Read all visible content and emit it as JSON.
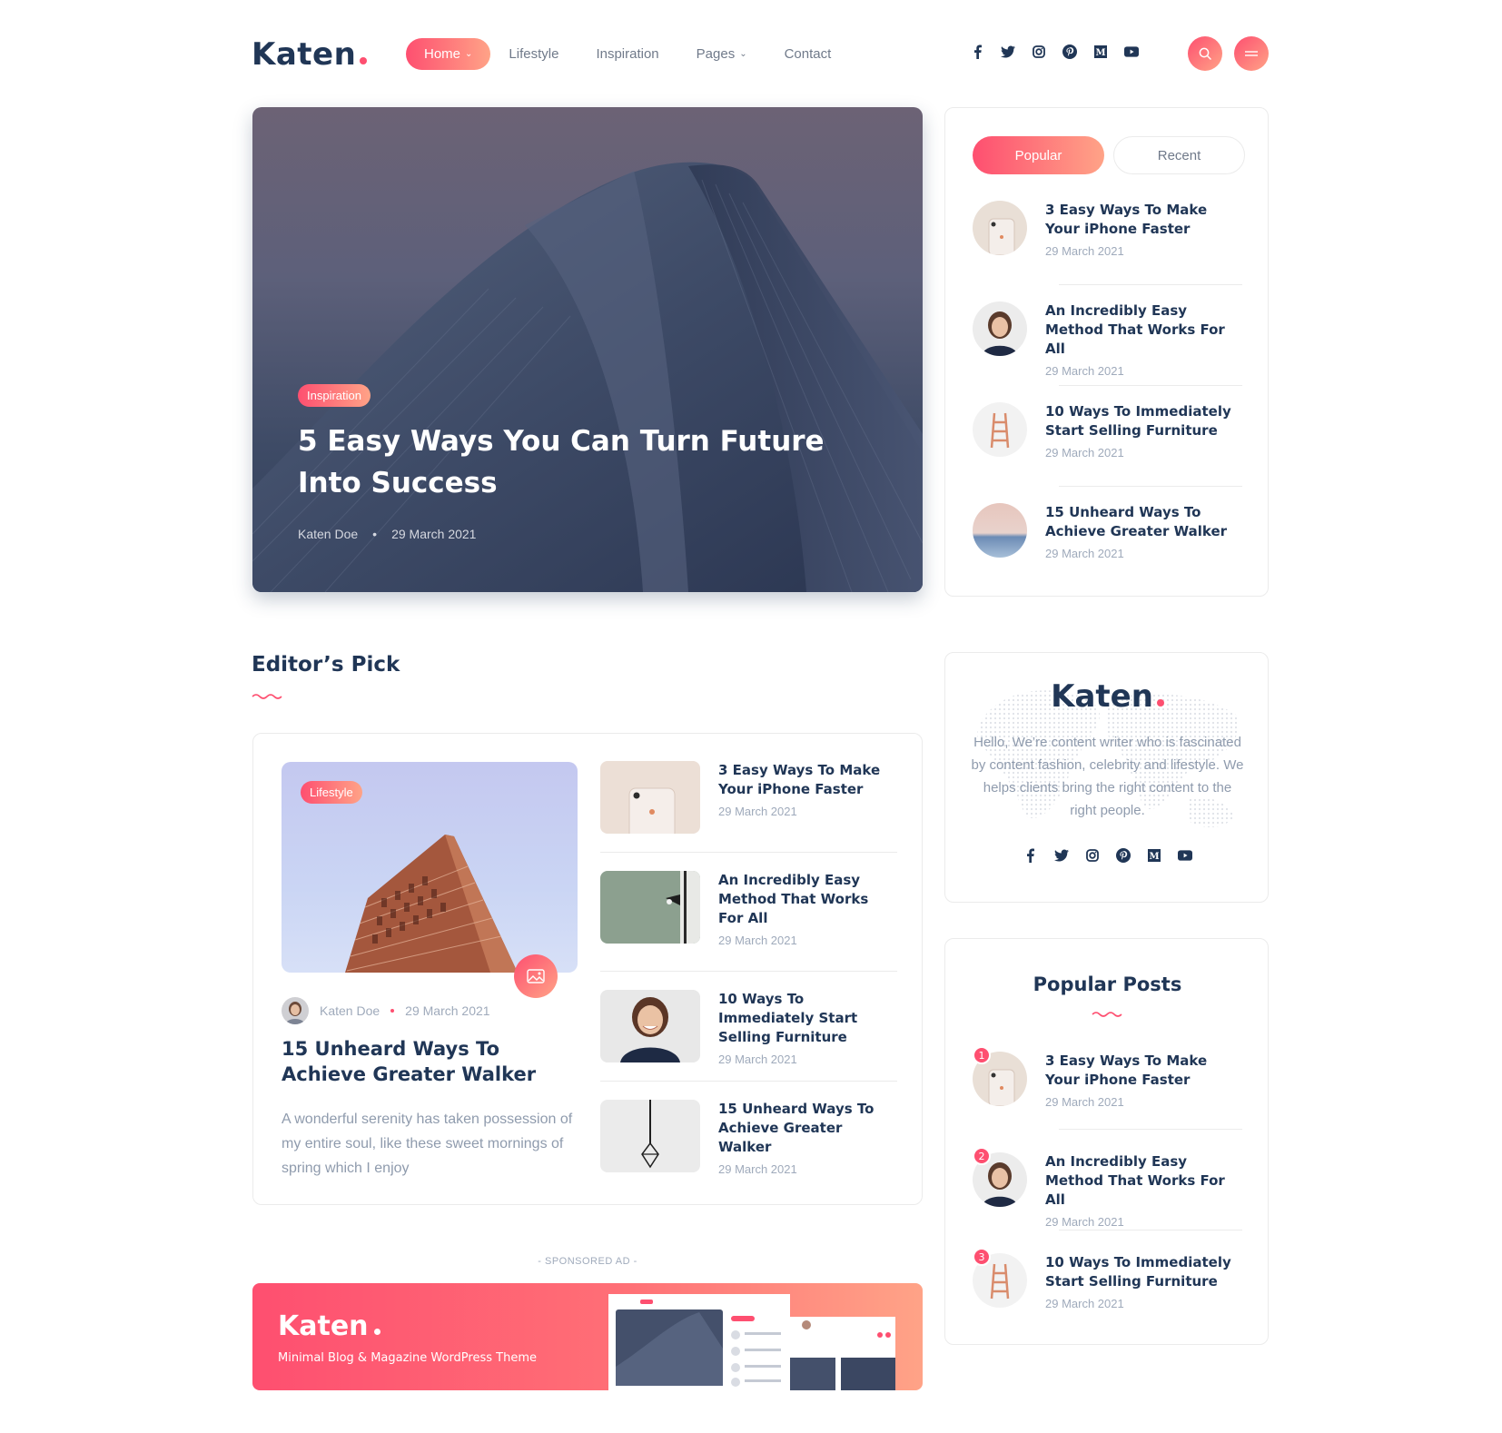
{
  "header": {
    "logo": "Katen",
    "nav": [
      {
        "label": "Home",
        "active": true,
        "dropdown": true
      },
      {
        "label": "Lifestyle",
        "active": false,
        "dropdown": false
      },
      {
        "label": "Inspiration",
        "active": false,
        "dropdown": false
      },
      {
        "label": "Pages",
        "active": false,
        "dropdown": true
      },
      {
        "label": "Contact",
        "active": false,
        "dropdown": false
      }
    ],
    "socials": [
      "facebook-icon",
      "twitter-icon",
      "instagram-icon",
      "pinterest-icon",
      "medium-icon",
      "youtube-icon"
    ]
  },
  "hero": {
    "category": "Inspiration",
    "title": "5 Easy Ways You Can Turn Future Into Success",
    "author": "Katen Doe",
    "date": "29 March 2021"
  },
  "tabs": {
    "popular_label": "Popular",
    "recent_label": "Recent",
    "posts": [
      {
        "title": "3 Easy Ways To Make Your iPhone Faster",
        "date": "29 March 2021"
      },
      {
        "title": "An Incredibly Easy Method That Works For All",
        "date": "29 March 2021"
      },
      {
        "title": "10 Ways To Immediately Start Selling Furniture",
        "date": "29 March 2021"
      },
      {
        "title": "15 Unheard Ways To Achieve Greater Walker",
        "date": "29 March 2021"
      }
    ]
  },
  "editors_pick": {
    "heading": "Editor’s Pick",
    "featured": {
      "category": "Lifestyle",
      "author": "Katen Doe",
      "date": "29 March 2021",
      "title": "15 Unheard Ways To Achieve Greater Walker",
      "excerpt": "A wonderful serenity has taken possession of my entire soul, like these sweet mornings of spring which I enjoy"
    },
    "list": [
      {
        "title": "3 Easy Ways To Make Your iPhone Faster",
        "date": "29 March 2021"
      },
      {
        "title": "An Incredibly Easy Method That Works For All",
        "date": "29 March 2021"
      },
      {
        "title": "10 Ways To Immediately Start Selling Furniture",
        "date": "29 March 2021"
      },
      {
        "title": "15 Unheard Ways To Achieve Greater Walker",
        "date": "29 March 2021"
      }
    ]
  },
  "sponsored": {
    "label": "- SPONSORED AD -",
    "logo": "Katen",
    "tagline": "Minimal Blog & Magazine WordPress Theme"
  },
  "about": {
    "logo": "Katen",
    "text": "Hello, We’re content writer who is fascinated by content fashion, celebrity and lifestyle. We helps clients bring the right content to the right people."
  },
  "popular_posts": {
    "heading": "Popular Posts",
    "posts": [
      {
        "rank": "1",
        "title": "3 Easy Ways To Make Your iPhone Faster",
        "date": "29 March 2021"
      },
      {
        "rank": "2",
        "title": "An Incredibly Easy Method That Works For All",
        "date": "29 March 2021"
      },
      {
        "rank": "3",
        "title": "10 Ways To Immediately Start Selling Furniture",
        "date": "29 March 2021"
      }
    ]
  },
  "colors": {
    "accent": "#fe4f70",
    "accent_light": "#ffa387",
    "heading": "#203656",
    "muted": "#9faabb"
  }
}
